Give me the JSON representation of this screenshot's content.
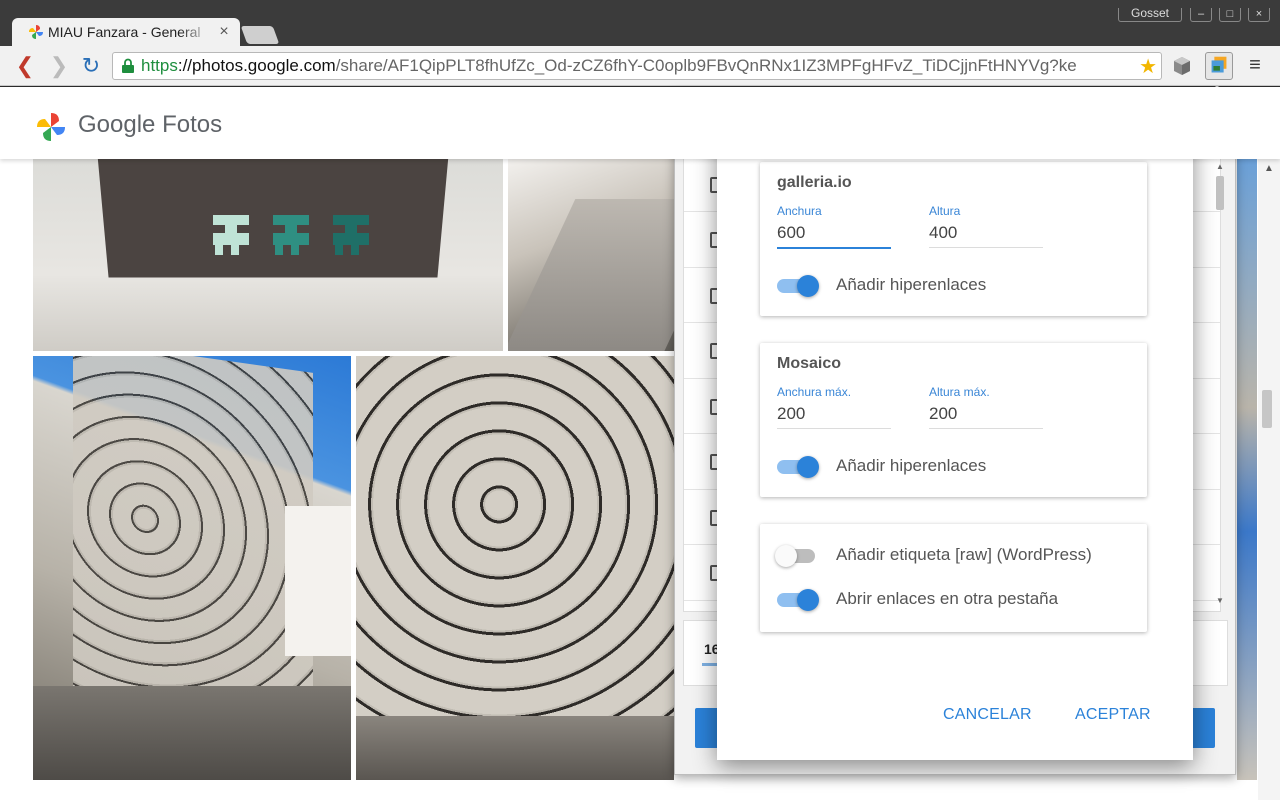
{
  "browser": {
    "tab_title": "MIAU Fanzara - General",
    "tab_close": "×",
    "window_user": "Gosset",
    "window_buttons": [
      "–",
      "□",
      "×"
    ],
    "url_scheme": "https",
    "url_sep": "://",
    "url_host": "photos.google.com",
    "url_path": "/share/AF1QipPLT8fhUfZc_Od-zCZ6fhY-C0oplb9FBvQnRNx1IZ3MPFgHFvZ_TiDCjjnFtHNYVg?ke",
    "nav_back": "❮",
    "nav_forward": "❯",
    "reload": "↻",
    "bookmark_star": "★",
    "menu": "≡",
    "page_scroll_up": "▲"
  },
  "google_photos": {
    "logo_google": "Google",
    "logo_product": "Fotos"
  },
  "popup": {
    "photo_count": "16",
    "scroll_up": "▲",
    "scroll_down": "▼",
    "row_count_visible": 9
  },
  "dialog": {
    "galleria": {
      "title": "galleria.io",
      "width_label": "Anchura",
      "width_value": "600",
      "height_label": "Altura",
      "height_value": "400",
      "links_label": "Añadir hiperenlaces",
      "links_on": true
    },
    "mosaic": {
      "title": "Mosaico",
      "width_label": "Anchura máx.",
      "width_value": "200",
      "height_label": "Altura máx.",
      "height_value": "200",
      "links_label": "Añadir hiperenlaces",
      "links_on": true
    },
    "options": {
      "raw_label": "Añadir etiqueta [raw] (WordPress)",
      "raw_on": false,
      "newtab_label": "Abrir enlaces en otra pestaña",
      "newtab_on": true
    },
    "cancel": "CANCELAR",
    "accept": "ACEPTAR"
  },
  "colors": {
    "accent_blue": "#2b82d9",
    "url_green": "#1e8e3e",
    "mural_teal": "#2f8f82"
  }
}
